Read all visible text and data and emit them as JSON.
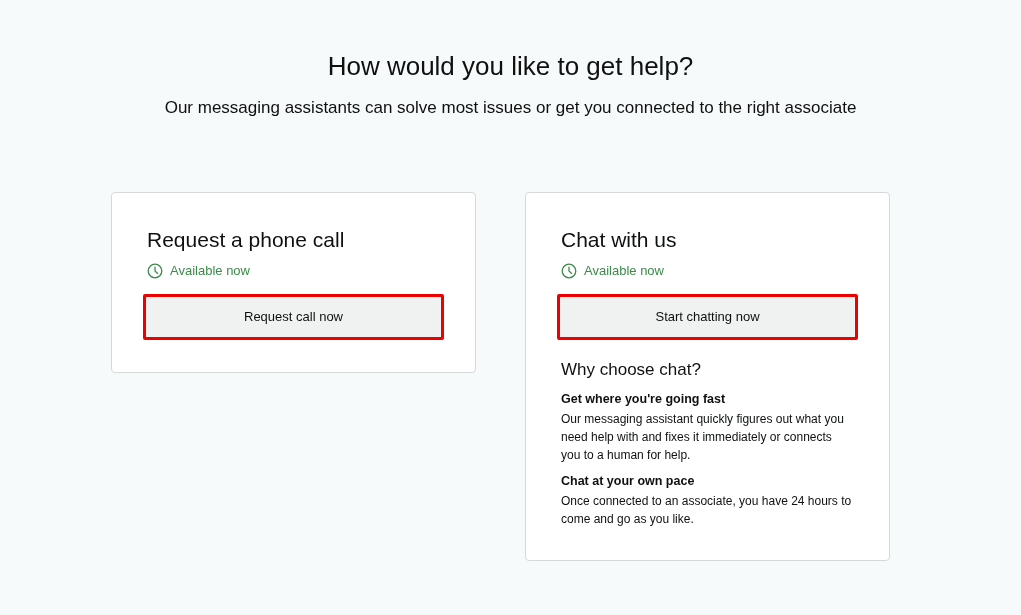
{
  "heading": "How would you like to get help?",
  "subheading": "Our messaging assistants can solve most issues or get you connected to the right associate",
  "options": [
    {
      "title": "Request a phone call",
      "availability": "Available now",
      "button": {
        "label": "Request call now",
        "highlighted": true
      }
    },
    {
      "title": "Chat with us",
      "availability": "Available now",
      "button": {
        "label": "Start chatting now",
        "highlighted": true
      },
      "reasons": {
        "title": "Why choose chat?",
        "items": [
          {
            "title": "Get where you're going fast",
            "text": "Our messaging assistant quickly figures out what you need help with and fixes it immediately or connects you to a human for help."
          },
          {
            "title": "Chat at your own pace",
            "text": "Once connected to an associate, you have 24 hours to come and go as you like."
          }
        ]
      }
    }
  ]
}
